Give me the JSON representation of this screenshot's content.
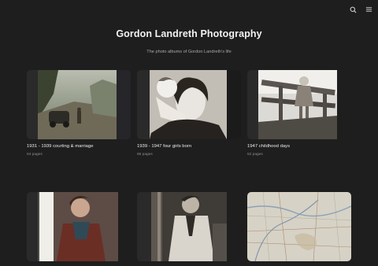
{
  "header": {
    "title": "Gordon Landreth Photography",
    "subtitle": "The photo albums of Gordon Landreth's life"
  },
  "toolbar": {
    "icons": [
      "search-icon",
      "menu-icon"
    ]
  },
  "albums": [
    {
      "title": "1931 - 1939 courting & marriage",
      "pages": "64 pages"
    },
    {
      "title": "1939 - 1947 four girls born",
      "pages": "86 pages"
    },
    {
      "title": "1947 childhood days",
      "pages": "52 pages"
    },
    {
      "title": "",
      "pages": ""
    },
    {
      "title": "",
      "pages": ""
    },
    {
      "title": "",
      "pages": ""
    }
  ],
  "colors": {
    "background": "#1e1e1e",
    "card": "#2a2a2a",
    "text": "#ececec",
    "muted": "#8d8d8d"
  }
}
